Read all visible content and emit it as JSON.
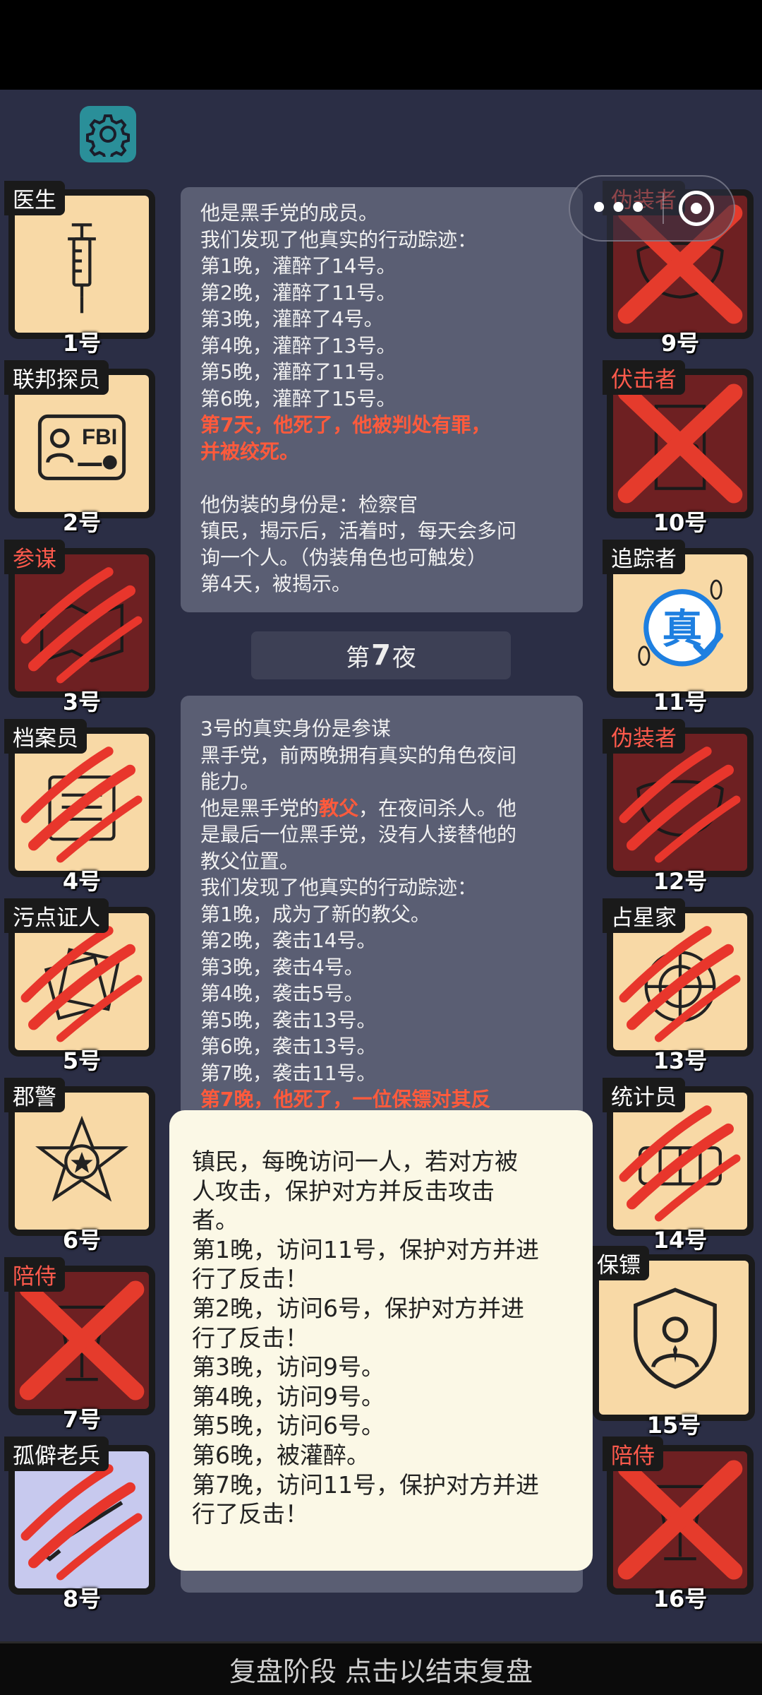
{
  "cards_left": [
    {
      "role": "医生",
      "number": "1号",
      "state": "alive",
      "icon": "syringe-icon"
    },
    {
      "role": "联邦探员",
      "number": "2号",
      "state": "alive",
      "icon": "fbi-badge-icon"
    },
    {
      "role": "参谋",
      "number": "3号",
      "state": "dead-claw",
      "icon": "map-icon"
    },
    {
      "role": "档案员",
      "number": "4号",
      "state": "dead-claw",
      "icon": "archive-icon"
    },
    {
      "role": "污点证人",
      "number": "5号",
      "state": "dead-claw",
      "icon": "papers-icon"
    },
    {
      "role": "郡警",
      "number": "6号",
      "state": "alive",
      "icon": "sheriff-star-icon"
    },
    {
      "role": "陪侍",
      "number": "7号",
      "state": "dead-x",
      "icon": "glass-icon"
    },
    {
      "role": "孤僻老兵",
      "number": "8号",
      "state": "dead-claw",
      "icon": "rifle-icon"
    }
  ],
  "cards_right": [
    {
      "role": "伪装者",
      "number": "9号",
      "state": "dead-x",
      "icon": "mask-icon"
    },
    {
      "role": "伏击者",
      "number": "10号",
      "state": "dead-x",
      "icon": "door-icon"
    },
    {
      "role": "追踪者",
      "number": "11号",
      "state": "alive",
      "icon": "truth-stamp-icon",
      "stamp": "真"
    },
    {
      "role": "伪装者",
      "number": "12号",
      "state": "dead-claw",
      "icon": "mask-icon"
    },
    {
      "role": "占星家",
      "number": "13号",
      "state": "dead-claw",
      "icon": "astrolabe-icon"
    },
    {
      "role": "统计员",
      "number": "14号",
      "state": "dead-claw",
      "icon": "counter-icon"
    },
    {
      "role": "保镖",
      "number": "15号",
      "state": "alive",
      "icon": "bodyguard-shield-icon"
    },
    {
      "role": "陪侍",
      "number": "16号",
      "state": "dead-x",
      "icon": "glass-icon"
    }
  ],
  "log_upper": [
    {
      "text": "他是黑手党的成员。",
      "hl": false
    },
    {
      "text": "我们发现了他真实的行动踪迹：",
      "hl": false
    },
    {
      "text": "第1晚，灌醉了14号。",
      "hl": false
    },
    {
      "text": "第2晚，灌醉了11号。",
      "hl": false
    },
    {
      "text": "第3晚，灌醉了4号。",
      "hl": false
    },
    {
      "text": "第4晚，灌醉了13号。",
      "hl": false
    },
    {
      "text": "第5晚，灌醉了11号。",
      "hl": false
    },
    {
      "text": "第6晚，灌醉了15号。",
      "hl": false
    },
    {
      "text": "第7天，他死了，他被判处有罪，",
      "hl": true
    },
    {
      "text": "并被绞死。",
      "hl": true
    },
    {
      "text": "",
      "hl": false
    },
    {
      "text": "他伪装的身份是：检察官",
      "hl": false
    },
    {
      "text": "镇民，揭示后，活着时，每天会多问",
      "hl": false
    },
    {
      "text": "询一个人。（伪装角色也可触发）",
      "hl": false
    },
    {
      "text": "第4天，被揭示。",
      "hl": false
    }
  ],
  "night_header": {
    "prefix": "第",
    "number": "7",
    "suffix": "夜"
  },
  "log_lower": [
    {
      "parts": [
        {
          "t": "3号的真实身份是参谋",
          "hl": false
        }
      ]
    },
    {
      "parts": [
        {
          "t": "黑手党，前两晚拥有真实的角色夜间",
          "hl": false
        }
      ]
    },
    {
      "parts": [
        {
          "t": "能力。",
          "hl": false
        }
      ]
    },
    {
      "parts": [
        {
          "t": "他是黑手党的",
          "hl": false
        },
        {
          "t": "教父",
          "hl": true
        },
        {
          "t": "，在夜间杀人。他",
          "hl": false
        }
      ]
    },
    {
      "parts": [
        {
          "t": "是最后一位黑手党，没有人接替他的",
          "hl": false
        }
      ]
    },
    {
      "parts": [
        {
          "t": "教父位置。",
          "hl": false
        }
      ]
    },
    {
      "parts": [
        {
          "t": "我们发现了他真实的行动踪迹：",
          "hl": false
        }
      ]
    },
    {
      "parts": [
        {
          "t": "第1晚，成为了新的教父。",
          "hl": false
        }
      ]
    },
    {
      "parts": [
        {
          "t": "第2晚，袭击14号。",
          "hl": false
        }
      ]
    },
    {
      "parts": [
        {
          "t": "第3晚，袭击4号。",
          "hl": false
        }
      ]
    },
    {
      "parts": [
        {
          "t": "第4晚，袭击5号。",
          "hl": false
        }
      ]
    },
    {
      "parts": [
        {
          "t": "第5晚，袭击13号。",
          "hl": false
        }
      ]
    },
    {
      "parts": [
        {
          "t": "第6晚，袭击13号。",
          "hl": false
        }
      ]
    },
    {
      "parts": [
        {
          "t": "第7晚，袭击11号。",
          "hl": false
        }
      ]
    },
    {
      "parts": [
        {
          "t": "第7晚，他死了，一位保镖对其反",
          "hl": true
        }
      ]
    }
  ],
  "popup_lines": [
    "镇民，每晚访问一人，若对方被",
    "人攻击，保护对方并反击攻击",
    "者。",
    "第1晚，访问11号，保护对方并进",
    "行了反击！",
    "第2晚，访问6号，保护对方并进",
    "行了反击！",
    "第3晚，访问9号。",
    "第4晚，访问9号。",
    "第5晚，访问6号。",
    "第6晚，被灌醉。",
    "第7晚，访问11号，保护对方并进",
    "行了反击！"
  ],
  "bottom_bar": "复盘阶段 点击以结束复盘",
  "colors": {
    "accent_red": "#ff5a3c",
    "card_cream": "#f8d9a6",
    "dead_card": "#6e2022",
    "background": "#2b2e45",
    "settings_teal": "#2a8f99"
  }
}
